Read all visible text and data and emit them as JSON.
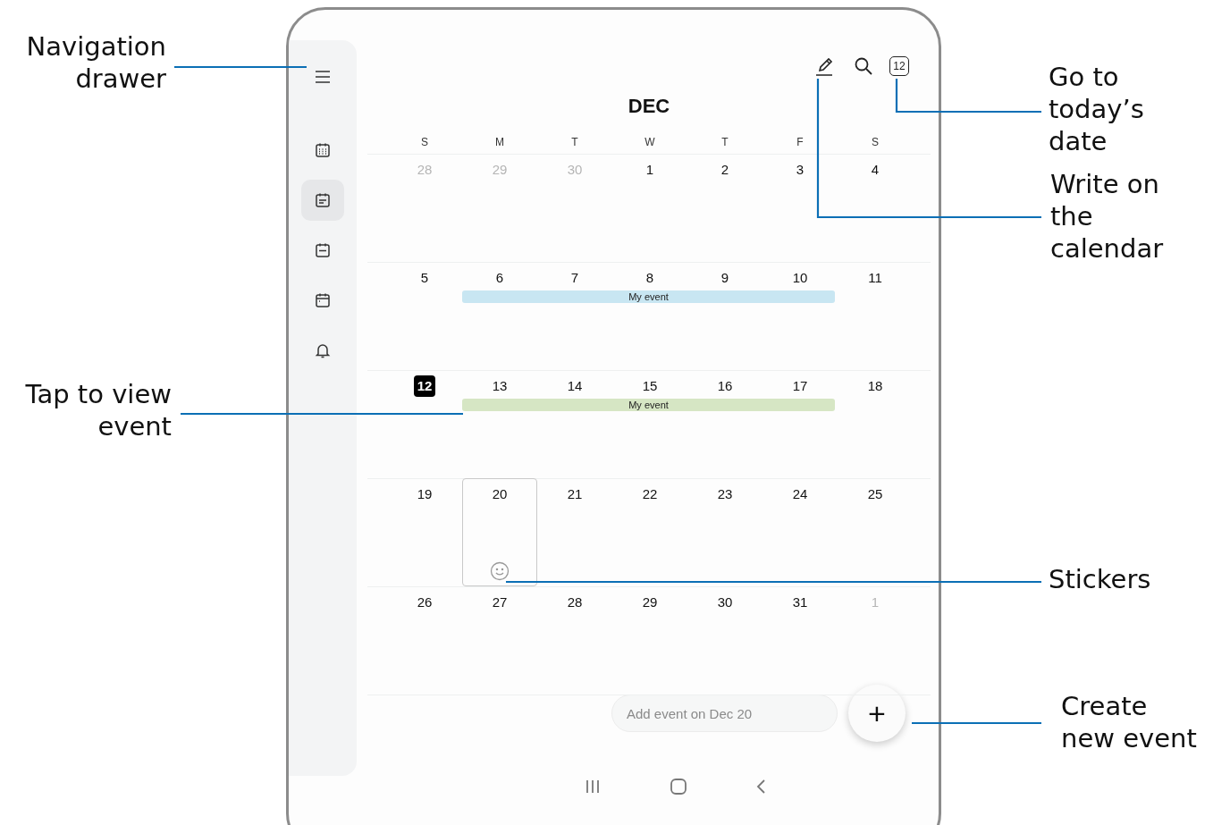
{
  "callouts": [
    {
      "kind": "drawer",
      "lines": [
        "Navigation",
        "drawer"
      ]
    },
    {
      "kind": "today",
      "lines": [
        "Go to",
        "today’s",
        "date"
      ]
    },
    {
      "kind": "write",
      "lines": [
        "Write on",
        "the",
        "calendar"
      ]
    },
    {
      "kind": "event",
      "lines": [
        "Tap to view",
        "event"
      ]
    },
    {
      "kind": "stickers",
      "lines": [
        "Stickers"
      ]
    },
    {
      "kind": "create",
      "lines": [
        "Create",
        "new event"
      ]
    }
  ],
  "sidebar": {
    "items": [
      {
        "kind": "menu",
        "selected": false
      },
      {
        "kind": "month",
        "selected": false
      },
      {
        "kind": "week",
        "selected": true
      },
      {
        "kind": "day",
        "selected": false
      },
      {
        "kind": "agenda",
        "selected": false
      },
      {
        "kind": "alerts",
        "selected": false
      }
    ]
  },
  "toolbar": {
    "today_badge": "12"
  },
  "month": "DEC",
  "weekdays": [
    "S",
    "M",
    "T",
    "W",
    "T",
    "F",
    "S"
  ],
  "weeks": [
    {
      "days": [
        {
          "label": "28",
          "muted": true
        },
        {
          "label": "29",
          "muted": true
        },
        {
          "label": "30",
          "muted": true
        },
        {
          "label": "1",
          "muted": false
        },
        {
          "label": "2",
          "muted": false
        },
        {
          "label": "3",
          "muted": false
        },
        {
          "label": "4",
          "muted": false
        }
      ]
    },
    {
      "days": [
        {
          "label": "5",
          "muted": false
        },
        {
          "label": "6",
          "muted": false
        },
        {
          "label": "7",
          "muted": false
        },
        {
          "label": "8",
          "muted": false
        },
        {
          "label": "9",
          "muted": false
        },
        {
          "label": "10",
          "muted": false
        },
        {
          "label": "11",
          "muted": false
        }
      ],
      "event": {
        "label": "My event",
        "color": "#c8e6f2"
      }
    },
    {
      "days": [
        {
          "label": "12",
          "muted": false,
          "today": true
        },
        {
          "label": "13",
          "muted": false
        },
        {
          "label": "14",
          "muted": false
        },
        {
          "label": "15",
          "muted": false
        },
        {
          "label": "16",
          "muted": false
        },
        {
          "label": "17",
          "muted": false
        },
        {
          "label": "18",
          "muted": false
        }
      ],
      "event": {
        "label": "My event",
        "color": "#d6e6c4"
      }
    },
    {
      "days": [
        {
          "label": "19",
          "muted": false
        },
        {
          "label": "20",
          "muted": false,
          "selected": true,
          "sticker": true
        },
        {
          "label": "21",
          "muted": false
        },
        {
          "label": "22",
          "muted": false
        },
        {
          "label": "23",
          "muted": false
        },
        {
          "label": "24",
          "muted": false
        },
        {
          "label": "25",
          "muted": false
        }
      ]
    },
    {
      "days": [
        {
          "label": "26",
          "muted": false
        },
        {
          "label": "27",
          "muted": false
        },
        {
          "label": "28",
          "muted": false
        },
        {
          "label": "29",
          "muted": false
        },
        {
          "label": "30",
          "muted": false
        },
        {
          "label": "31",
          "muted": false
        },
        {
          "label": "1",
          "muted": true
        }
      ]
    }
  ],
  "add_event": {
    "placeholder": "Add event on Dec 20"
  },
  "fab": {
    "label": "+"
  }
}
